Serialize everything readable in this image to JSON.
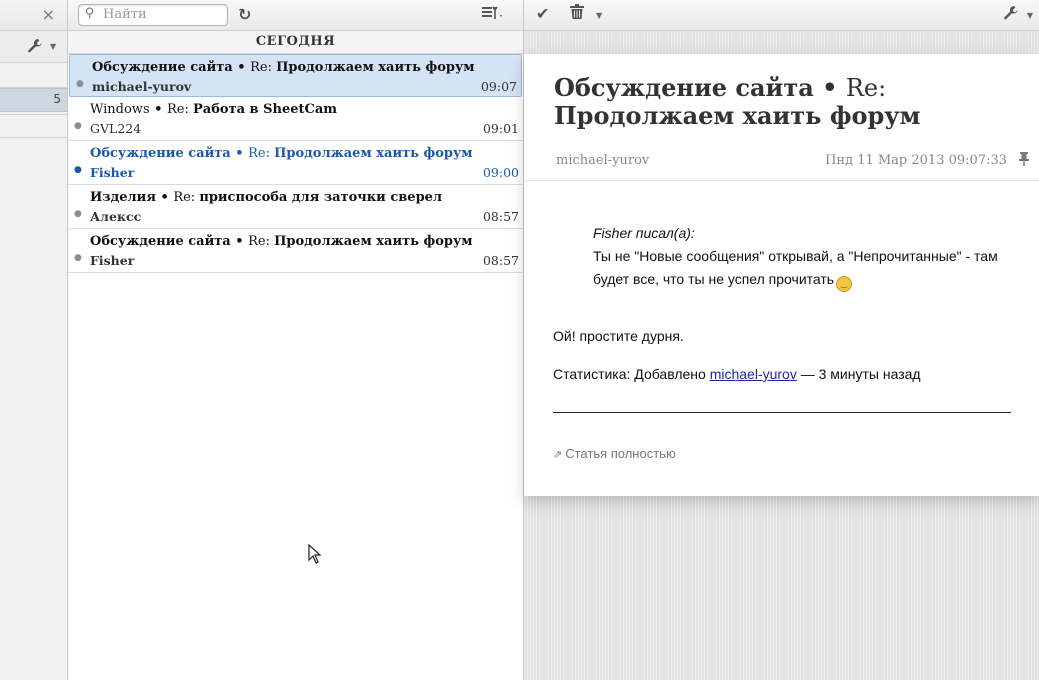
{
  "search": {
    "placeholder": "Найти"
  },
  "sidebar": {
    "close_label": "×",
    "unread_count": "5"
  },
  "list": {
    "day_header": "СЕГОДНЯ",
    "items": [
      {
        "feed": "Обсуждение сайта",
        "sep": " • ",
        "re": "Re: ",
        "title": "Продолжаем хаить форум",
        "author": "michael-yurov",
        "time": "09:07",
        "state": "selected"
      },
      {
        "feed": "Windows",
        "sep": " • ",
        "re": "Re: ",
        "title": "Работа в SheetCam",
        "author": "GVL224",
        "time": "09:01",
        "state": "read"
      },
      {
        "feed": "Обсуждение сайта",
        "sep": " • ",
        "re": "Re: ",
        "title": "Продолжаем хаить форум",
        "author": "Fisher",
        "time": "09:00",
        "state": "unread"
      },
      {
        "feed": "Изделия",
        "sep": " • ",
        "re": "Re: ",
        "title": "приспособа для заточки сверел",
        "author": "Алексс",
        "time": "08:57",
        "state": "read"
      },
      {
        "feed": "Обсуждение сайта",
        "sep": " • ",
        "re": "Re: ",
        "title": "Продолжаем хаить форум",
        "author": "Fisher",
        "time": "08:57",
        "state": "read"
      }
    ]
  },
  "article": {
    "title_feed": "Обсуждение сайта",
    "title_sep": " • ",
    "title_re": "Re:",
    "title_text": "Продолжаем хаить форум",
    "author": "michael-yurov",
    "date": "Пнд 11 Мар 2013 09:07:33",
    "quote_author": "Fisher писал(а):",
    "quote_text": "Ты не \"Новые сообщения\" открывай, а \"Непрочитанные\" - там будет все, что ты не успел прочитать",
    "paragraph": "Ой! простите дурня.",
    "stats_prefix": "Статистика: Добавлено ",
    "stats_author": "michael-yurov",
    "stats_suffix": " — 3 минуты назад",
    "full_link": "Статья полностью"
  },
  "colors": {
    "unread": "#1a5aa8",
    "selected_bg": "#d4e3f5"
  },
  "icons": [
    "close-icon",
    "wrench-icon",
    "search-icon",
    "reload-icon",
    "view-menu-icon",
    "check-icon",
    "trash-icon",
    "pin-icon",
    "external-link-icon",
    "smiley-icon"
  ]
}
